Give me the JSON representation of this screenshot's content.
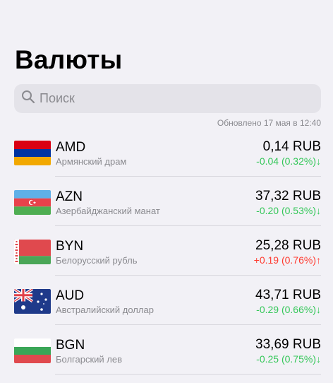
{
  "header": {
    "title": "Валюты"
  },
  "search": {
    "placeholder": "Поиск"
  },
  "updated": "Обновлено 17 мая в 12:40",
  "currencies": [
    {
      "code": "AMD",
      "name": "Армянский драм",
      "rate": "0,14 RUB",
      "change": "-0.04 (0.32%)↓",
      "trend": "down"
    },
    {
      "code": "AZN",
      "name": "Азербайджанский манат",
      "rate": "37,32 RUB",
      "change": "-0.20 (0.53%)↓",
      "trend": "down"
    },
    {
      "code": "BYN",
      "name": "Белорусский рубль",
      "rate": "25,28 RUB",
      "change": "+0.19 (0.76%)↑",
      "trend": "up"
    },
    {
      "code": "AUD",
      "name": "Австралийский доллар",
      "rate": "43,71 RUB",
      "change": "-0.29 (0.66%)↓",
      "trend": "down"
    },
    {
      "code": "BGN",
      "name": "Болгарский лев",
      "rate": "33,69 RUB",
      "change": "-0.25 (0.75%)↓",
      "trend": "down"
    }
  ],
  "colors": {
    "down": "#34c759",
    "up": "#ff3b30",
    "background": "#f2f1f6"
  }
}
